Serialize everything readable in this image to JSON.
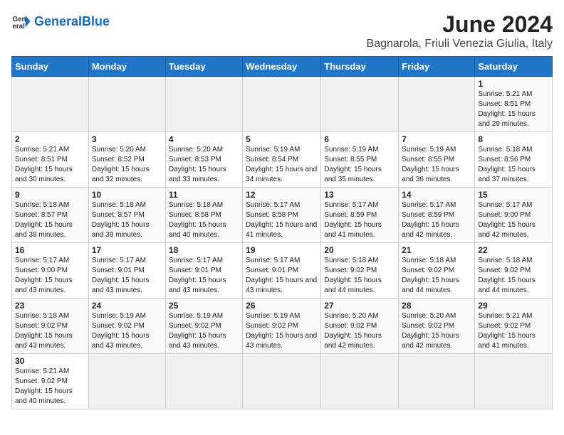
{
  "header": {
    "logo_general": "General",
    "logo_blue": "Blue",
    "title": "June 2024",
    "subtitle": "Bagnarola, Friuli Venezia Giulia, Italy"
  },
  "weekdays": [
    "Sunday",
    "Monday",
    "Tuesday",
    "Wednesday",
    "Thursday",
    "Friday",
    "Saturday"
  ],
  "weeks": [
    [
      {
        "day": "",
        "info": ""
      },
      {
        "day": "",
        "info": ""
      },
      {
        "day": "",
        "info": ""
      },
      {
        "day": "",
        "info": ""
      },
      {
        "day": "",
        "info": ""
      },
      {
        "day": "",
        "info": ""
      },
      {
        "day": "1",
        "info": "Sunrise: 5:21 AM\nSunset: 8:51 PM\nDaylight: 15 hours and 29 minutes."
      }
    ],
    [
      {
        "day": "2",
        "info": "Sunrise: 5:21 AM\nSunset: 8:51 PM\nDaylight: 15 hours and 30 minutes."
      },
      {
        "day": "3",
        "info": "Sunrise: 5:20 AM\nSunset: 8:52 PM\nDaylight: 15 hours and 32 minutes."
      },
      {
        "day": "4",
        "info": "Sunrise: 5:20 AM\nSunset: 8:53 PM\nDaylight: 15 hours and 33 minutes."
      },
      {
        "day": "5",
        "info": "Sunrise: 5:19 AM\nSunset: 8:54 PM\nDaylight: 15 hours and 34 minutes."
      },
      {
        "day": "6",
        "info": "Sunrise: 5:19 AM\nSunset: 8:55 PM\nDaylight: 15 hours and 35 minutes."
      },
      {
        "day": "7",
        "info": "Sunrise: 5:19 AM\nSunset: 8:55 PM\nDaylight: 15 hours and 36 minutes."
      },
      {
        "day": "8",
        "info": "Sunrise: 5:18 AM\nSunset: 8:56 PM\nDaylight: 15 hours and 37 minutes."
      }
    ],
    [
      {
        "day": "9",
        "info": "Sunrise: 5:18 AM\nSunset: 8:57 PM\nDaylight: 15 hours and 38 minutes."
      },
      {
        "day": "10",
        "info": "Sunrise: 5:18 AM\nSunset: 8:57 PM\nDaylight: 15 hours and 39 minutes."
      },
      {
        "day": "11",
        "info": "Sunrise: 5:18 AM\nSunset: 8:58 PM\nDaylight: 15 hours and 40 minutes."
      },
      {
        "day": "12",
        "info": "Sunrise: 5:17 AM\nSunset: 8:58 PM\nDaylight: 15 hours and 41 minutes."
      },
      {
        "day": "13",
        "info": "Sunrise: 5:17 AM\nSunset: 8:59 PM\nDaylight: 15 hours and 41 minutes."
      },
      {
        "day": "14",
        "info": "Sunrise: 5:17 AM\nSunset: 8:59 PM\nDaylight: 15 hours and 42 minutes."
      },
      {
        "day": "15",
        "info": "Sunrise: 5:17 AM\nSunset: 9:00 PM\nDaylight: 15 hours and 42 minutes."
      }
    ],
    [
      {
        "day": "16",
        "info": "Sunrise: 5:17 AM\nSunset: 9:00 PM\nDaylight: 15 hours and 43 minutes."
      },
      {
        "day": "17",
        "info": "Sunrise: 5:17 AM\nSunset: 9:01 PM\nDaylight: 15 hours and 43 minutes."
      },
      {
        "day": "18",
        "info": "Sunrise: 5:17 AM\nSunset: 9:01 PM\nDaylight: 15 hours and 43 minutes."
      },
      {
        "day": "19",
        "info": "Sunrise: 5:17 AM\nSunset: 9:01 PM\nDaylight: 15 hours and 43 minutes."
      },
      {
        "day": "20",
        "info": "Sunrise: 5:18 AM\nSunset: 9:02 PM\nDaylight: 15 hours and 44 minutes."
      },
      {
        "day": "21",
        "info": "Sunrise: 5:18 AM\nSunset: 9:02 PM\nDaylight: 15 hours and 44 minutes."
      },
      {
        "day": "22",
        "info": "Sunrise: 5:18 AM\nSunset: 9:02 PM\nDaylight: 15 hours and 44 minutes."
      }
    ],
    [
      {
        "day": "23",
        "info": "Sunrise: 5:18 AM\nSunset: 9:02 PM\nDaylight: 15 hours and 43 minutes."
      },
      {
        "day": "24",
        "info": "Sunrise: 5:19 AM\nSunset: 9:02 PM\nDaylight: 15 hours and 43 minutes."
      },
      {
        "day": "25",
        "info": "Sunrise: 5:19 AM\nSunset: 9:02 PM\nDaylight: 15 hours and 43 minutes."
      },
      {
        "day": "26",
        "info": "Sunrise: 5:19 AM\nSunset: 9:02 PM\nDaylight: 15 hours and 43 minutes."
      },
      {
        "day": "27",
        "info": "Sunrise: 5:20 AM\nSunset: 9:02 PM\nDaylight: 15 hours and 42 minutes."
      },
      {
        "day": "28",
        "info": "Sunrise: 5:20 AM\nSunset: 9:02 PM\nDaylight: 15 hours and 42 minutes."
      },
      {
        "day": "29",
        "info": "Sunrise: 5:21 AM\nSunset: 9:02 PM\nDaylight: 15 hours and 41 minutes."
      }
    ],
    [
      {
        "day": "30",
        "info": "Sunrise: 5:21 AM\nSunset: 9:02 PM\nDaylight: 15 hours and 40 minutes."
      },
      {
        "day": "",
        "info": ""
      },
      {
        "day": "",
        "info": ""
      },
      {
        "day": "",
        "info": ""
      },
      {
        "day": "",
        "info": ""
      },
      {
        "day": "",
        "info": ""
      },
      {
        "day": "",
        "info": ""
      }
    ]
  ]
}
